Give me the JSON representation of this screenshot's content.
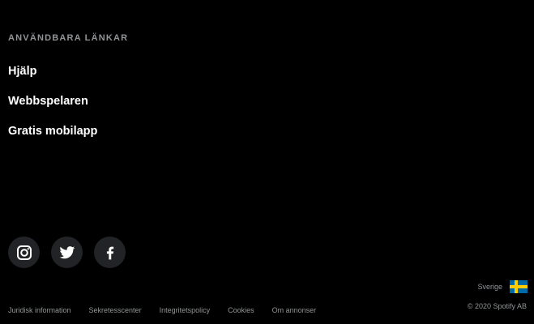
{
  "links_section": {
    "heading": "ANVÄNDBARA LÄNKAR",
    "items": [
      {
        "label": "Hjälp"
      },
      {
        "label": "Webbspelaren"
      },
      {
        "label": "Gratis mobilapp"
      }
    ]
  },
  "social": [
    {
      "icon": "instagram-icon"
    },
    {
      "icon": "twitter-icon"
    },
    {
      "icon": "facebook-icon"
    }
  ],
  "country": {
    "label": "Sverige",
    "flag": "sweden-flag",
    "flag_colors": {
      "blue": "#006aa7",
      "yellow": "#fecc00"
    }
  },
  "legal_links": [
    {
      "label": "Juridisk information"
    },
    {
      "label": "Sekretesscenter"
    },
    {
      "label": "Integritetspolicy"
    },
    {
      "label": "Cookies"
    },
    {
      "label": "Om annonser"
    }
  ],
  "copyright": "© 2020 Spotify AB",
  "colors": {
    "background": "#000000",
    "text": "#ffffff",
    "muted": "#919496",
    "social_bg": "#222326"
  }
}
